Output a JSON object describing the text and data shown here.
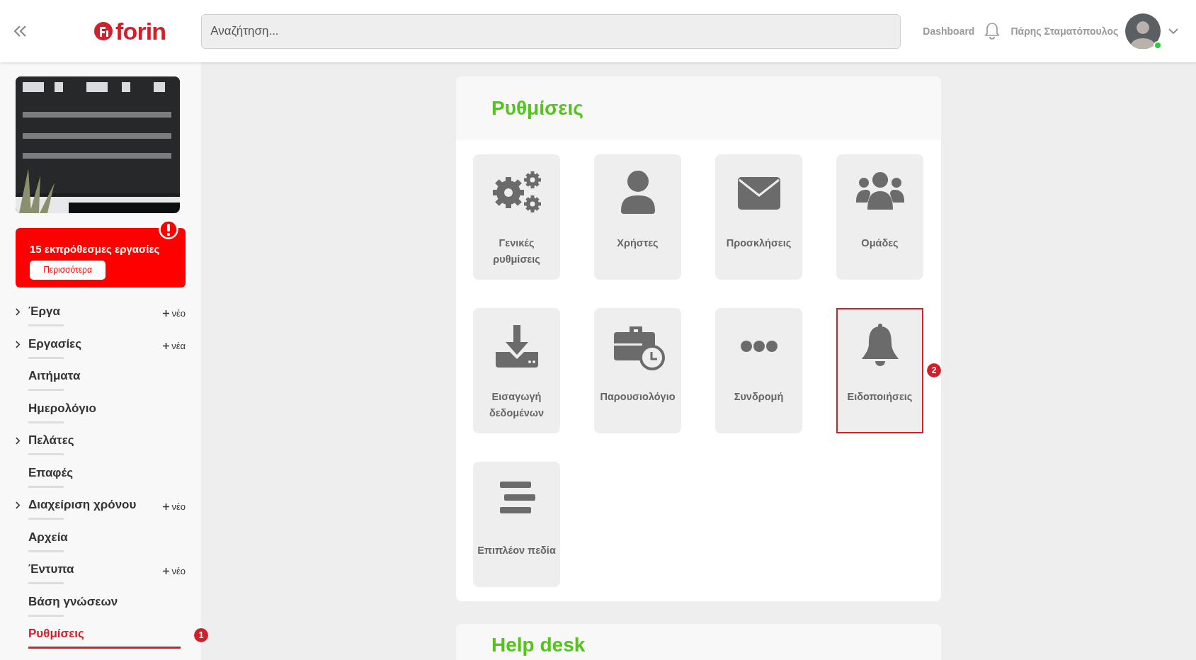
{
  "header": {
    "logo": "forin",
    "search": {
      "placeholder": "Αναζήτηση..."
    },
    "dashboard_link": "Dashboard",
    "user_name": "Πάρης Σταματόπουλος",
    "user_online": true
  },
  "sidebar": {
    "alert": {
      "text": "15 εκπρόθεσμες εργασίες",
      "button": "Περισσότερα"
    },
    "items": [
      {
        "label": "Έργα",
        "expandable": true,
        "add": "νέο",
        "selected": false
      },
      {
        "label": "Εργασίες",
        "expandable": true,
        "add": "νέα",
        "selected": false
      },
      {
        "label": "Αιτήματα",
        "expandable": false,
        "selected": false
      },
      {
        "label": "Ημερολόγιο",
        "expandable": false,
        "selected": false
      },
      {
        "label": "Πελάτες",
        "expandable": true,
        "selected": false
      },
      {
        "label": "Επαφές",
        "expandable": false,
        "selected": false
      },
      {
        "label": "Διαχείριση χρόνου",
        "expandable": true,
        "add": "νέο",
        "selected": false
      },
      {
        "label": "Αρχεία",
        "expandable": false,
        "selected": false
      },
      {
        "label": "Έντυπα",
        "expandable": false,
        "add": "νέο",
        "selected": false
      },
      {
        "label": "Βάση γνώσεων",
        "expandable": false,
        "selected": false
      },
      {
        "label": "Ρυθμίσεις",
        "expandable": false,
        "selected": true,
        "marker": "1"
      }
    ]
  },
  "settings": {
    "title": "Ρυθμίσεις",
    "tiles": [
      {
        "kind": "gears",
        "label": "Γενικές ρυθμίσεις",
        "highlighted": false
      },
      {
        "kind": "user",
        "label": "Χρήστες",
        "highlighted": false
      },
      {
        "kind": "envelope",
        "label": "Προσκλήσεις",
        "highlighted": false
      },
      {
        "kind": "users",
        "label": "Ομάδες",
        "highlighted": false
      },
      {
        "kind": "download",
        "label": "Εισαγωγή δεδομένων",
        "highlighted": false
      },
      {
        "kind": "briefcase",
        "label": "Παρουσιολόγιο",
        "highlighted": false
      },
      {
        "kind": "dots",
        "label": "Συνδρομή",
        "highlighted": false
      },
      {
        "kind": "bell",
        "label": "Ειδοποιήσεις",
        "highlighted": true,
        "marker": "2"
      },
      {
        "kind": "bars",
        "label": "Επιπλέον πεδία",
        "highlighted": false
      }
    ]
  },
  "help_desk": {
    "title": "Help desk"
  }
}
